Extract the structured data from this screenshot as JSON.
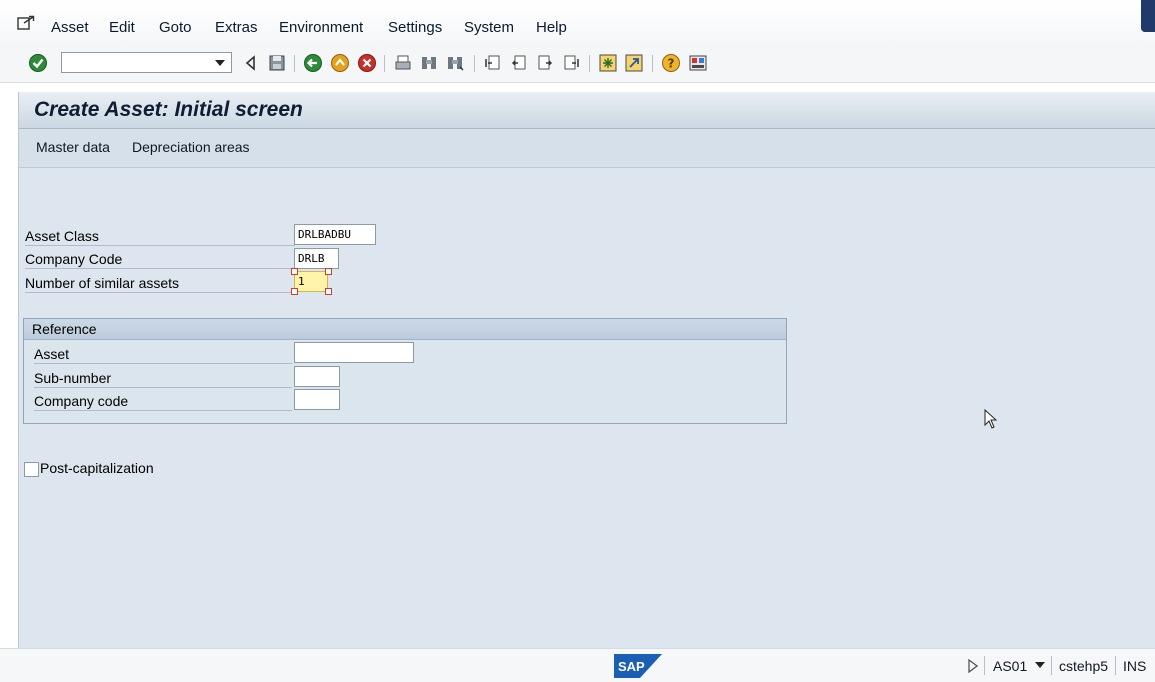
{
  "menu": {
    "items": [
      {
        "label": "Asset"
      },
      {
        "label": "Edit"
      },
      {
        "label": "Goto"
      },
      {
        "label": "Extras"
      },
      {
        "label": "Environment"
      },
      {
        "label": "Settings"
      },
      {
        "label": "System"
      },
      {
        "label": "Help"
      }
    ]
  },
  "toolbar": {
    "command_field_value": "",
    "icons": [
      "enter-icon",
      "back-nav-icon",
      "save-icon",
      "back-icon",
      "exit-icon",
      "cancel-icon",
      "print-icon",
      "find-icon",
      "find-next-icon",
      "first-page-icon",
      "previous-page-icon",
      "next-page-icon",
      "last-page-icon",
      "create-session-icon",
      "shortcut-icon",
      "help-icon",
      "layout-icon"
    ]
  },
  "page": {
    "title": "Create Asset:  Initial screen"
  },
  "app_toolbar": {
    "master_data": "Master data",
    "depreciation_areas": "Depreciation areas"
  },
  "fields": {
    "asset_class": {
      "label": "Asset Class",
      "value": "DRLBADBU"
    },
    "company_code": {
      "label": "Company Code",
      "value": "DRLB"
    },
    "number_similar": {
      "label": "Number of similar assets",
      "value": "1"
    }
  },
  "reference": {
    "title": "Reference",
    "asset": {
      "label": "Asset",
      "value": ""
    },
    "sub_number": {
      "label": "Sub-number",
      "value": ""
    },
    "company_code": {
      "label": "Company code",
      "value": ""
    }
  },
  "post_capitalization": {
    "label": "Post-capitalization",
    "checked": false
  },
  "status_bar": {
    "transaction": "AS01",
    "server": "cstehp5",
    "mode": "INS",
    "logo": "SAP"
  },
  "colors": {
    "title_text": "#0f1e33",
    "panel_bg": "#dde6ee",
    "focus_field": "#fff4a8"
  }
}
